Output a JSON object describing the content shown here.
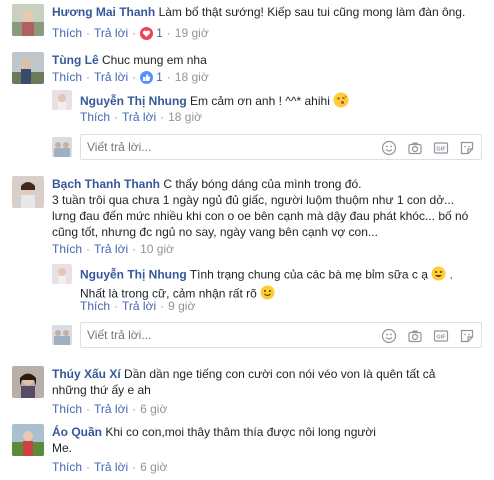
{
  "comments": [
    {
      "author": "Hương Mai Thanh",
      "text": "Làm bố thật sướng! Kiếp sau tui cũng mong làm đàn ông.",
      "like": "Thích",
      "reply": "Trả lời",
      "reaction_count": "1",
      "time": "19 giờ",
      "reaction_color": "#f33e58"
    },
    {
      "author": "Tùng Lê",
      "text": "Chuc mung em nha",
      "like": "Thích",
      "reply": "Trả lời",
      "reaction_count": "1",
      "time": "18 giờ",
      "reaction_color": "#5890ff",
      "reply_item": {
        "author": "Nguyễn Thị Nhung",
        "text": "Em cảm ơn anh ! ^^* ahihi",
        "like": "Thích",
        "reply": "Trả lời",
        "time": "18 giờ"
      }
    },
    {
      "author": "Bạch Thanh Thanh",
      "text_lines": [
        "C thấy bóng dáng của mình trong đó.",
        "3 tuần trôi qua chưa 1 ngày ngủ đủ giấc, người luộm thuộm như 1 con dở...",
        "lưng đau đến mức nhiều khi con o oe bên cạnh mà dậy đau phát khóc... bố nó",
        "cũng tốt, nhưng đc ngủ no say, ngày vang bên cạnh vợ con..."
      ],
      "like": "Thích",
      "reply": "Trả lời",
      "time": "10 giờ",
      "reply_item": {
        "author": "Nguyễn Thị Nhung",
        "text_line1": "Tình trạng chung của các bà mẹ bỉm sữa c ạ",
        "text_line2": "Nhất là trong cữ, cảm nhận rất rõ",
        "like": "Thích",
        "reply": "Trả lời",
        "time": "9 giờ"
      }
    },
    {
      "author": "Thúy Xấu Xí",
      "text_line1": "Dần dần nge tiếng con cười con nói véo von là quên tất cả",
      "text_line2": "những thứ ấy e ah",
      "like": "Thích",
      "reply": "Trả lời",
      "time": "6 giờ"
    },
    {
      "author": "Áo Quần",
      "text_line1": "Khi co con,moi thây thâm thía được nôi long người",
      "text_line2": "Me.",
      "like": "Thích",
      "reply": "Trả lời",
      "time": "6 giờ"
    }
  ],
  "reply_placeholder": "Viết trả lời...",
  "icons": [
    "emoji-icon",
    "camera-icon",
    "gif-icon",
    "sticker-icon",
    "heart-reaction-icon",
    "like-reaction-icon",
    "grin-emoji-icon",
    "kiss-emoji-icon",
    "smile-emoji-icon"
  ]
}
